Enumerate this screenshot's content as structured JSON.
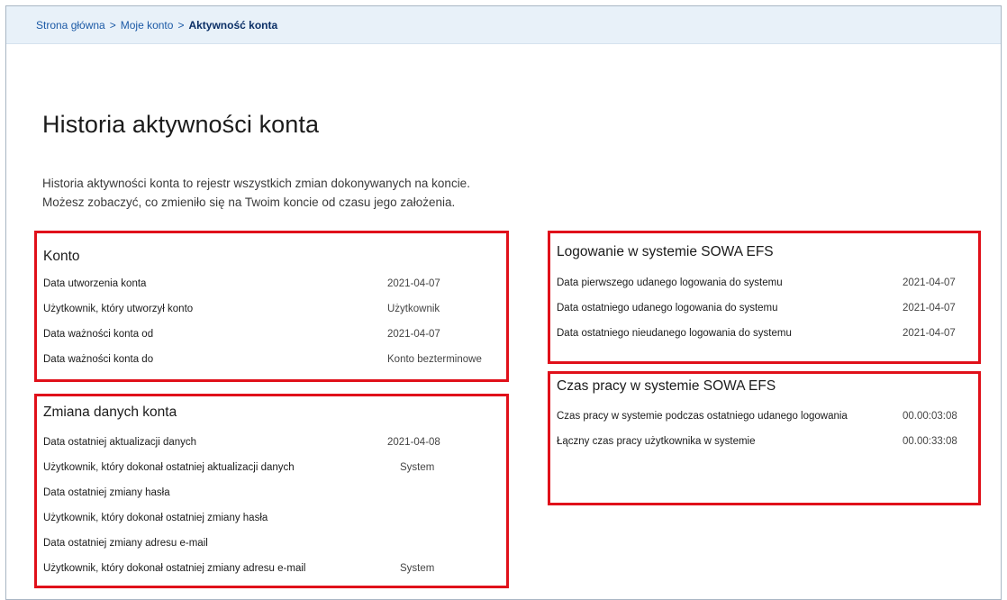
{
  "breadcrumb": {
    "home": "Strona główna",
    "separator": ">",
    "account": "Moje konto",
    "current": "Aktywność konta"
  },
  "page": {
    "title": "Historia aktywności konta",
    "intro_line1": "Historia aktywności konta to rejestr wszystkich zmian dokonywanych na koncie.",
    "intro_line2": "Możesz zobaczyć, co zmieniło się na Twoim koncie od czasu jego założenia."
  },
  "cards": {
    "konto": {
      "title": "Konto",
      "rows": [
        {
          "label": "Data utworzenia konta",
          "value": "2021-04-07"
        },
        {
          "label": "Użytkownik, który utworzył konto",
          "value": "Użytkownik"
        },
        {
          "label": "Data ważności konta od",
          "value": "2021-04-07"
        },
        {
          "label": "Data ważności konta do",
          "value": "Konto bezterminowe"
        }
      ]
    },
    "zmiana": {
      "title": "Zmiana danych konta",
      "rows": [
        {
          "label": "Data ostatniej aktualizacji danych",
          "value": "2021-04-08"
        },
        {
          "label": "Użytkownik, który dokonał ostatniej aktualizacji danych",
          "value": "System"
        },
        {
          "label": "Data ostatniej zmiany hasła",
          "value": ""
        },
        {
          "label": "Użytkownik, który dokonał ostatniej zmiany hasła",
          "value": ""
        },
        {
          "label": "Data ostatniej zmiany adresu e-mail",
          "value": ""
        },
        {
          "label": "Użytkownik, który dokonał ostatniej zmiany adresu e-mail",
          "value": "System"
        }
      ]
    },
    "logowanie": {
      "title": "Logowanie w systemie SOWA EFS",
      "rows": [
        {
          "label": "Data pierwszego udanego logowania do systemu",
          "value": "2021-04-07"
        },
        {
          "label": "Data ostatniego udanego logowania do systemu",
          "value": "2021-04-07"
        },
        {
          "label": "Data ostatniego nieudanego logowania do systemu",
          "value": "2021-04-07"
        }
      ]
    },
    "czas": {
      "title": "Czas pracy w systemie SOWA EFS",
      "rows": [
        {
          "label": "Czas pracy w systemie podczas ostatniego udanego logowania",
          "value": "00.00:03:08"
        },
        {
          "label": "Łączny czas pracy użytkownika w systemie",
          "value": "00.00:33:08"
        }
      ]
    }
  },
  "colors": {
    "highlight_border": "#e0101a",
    "breadcrumb_bg": "#e8f1f9",
    "link": "#1c5aa6"
  }
}
